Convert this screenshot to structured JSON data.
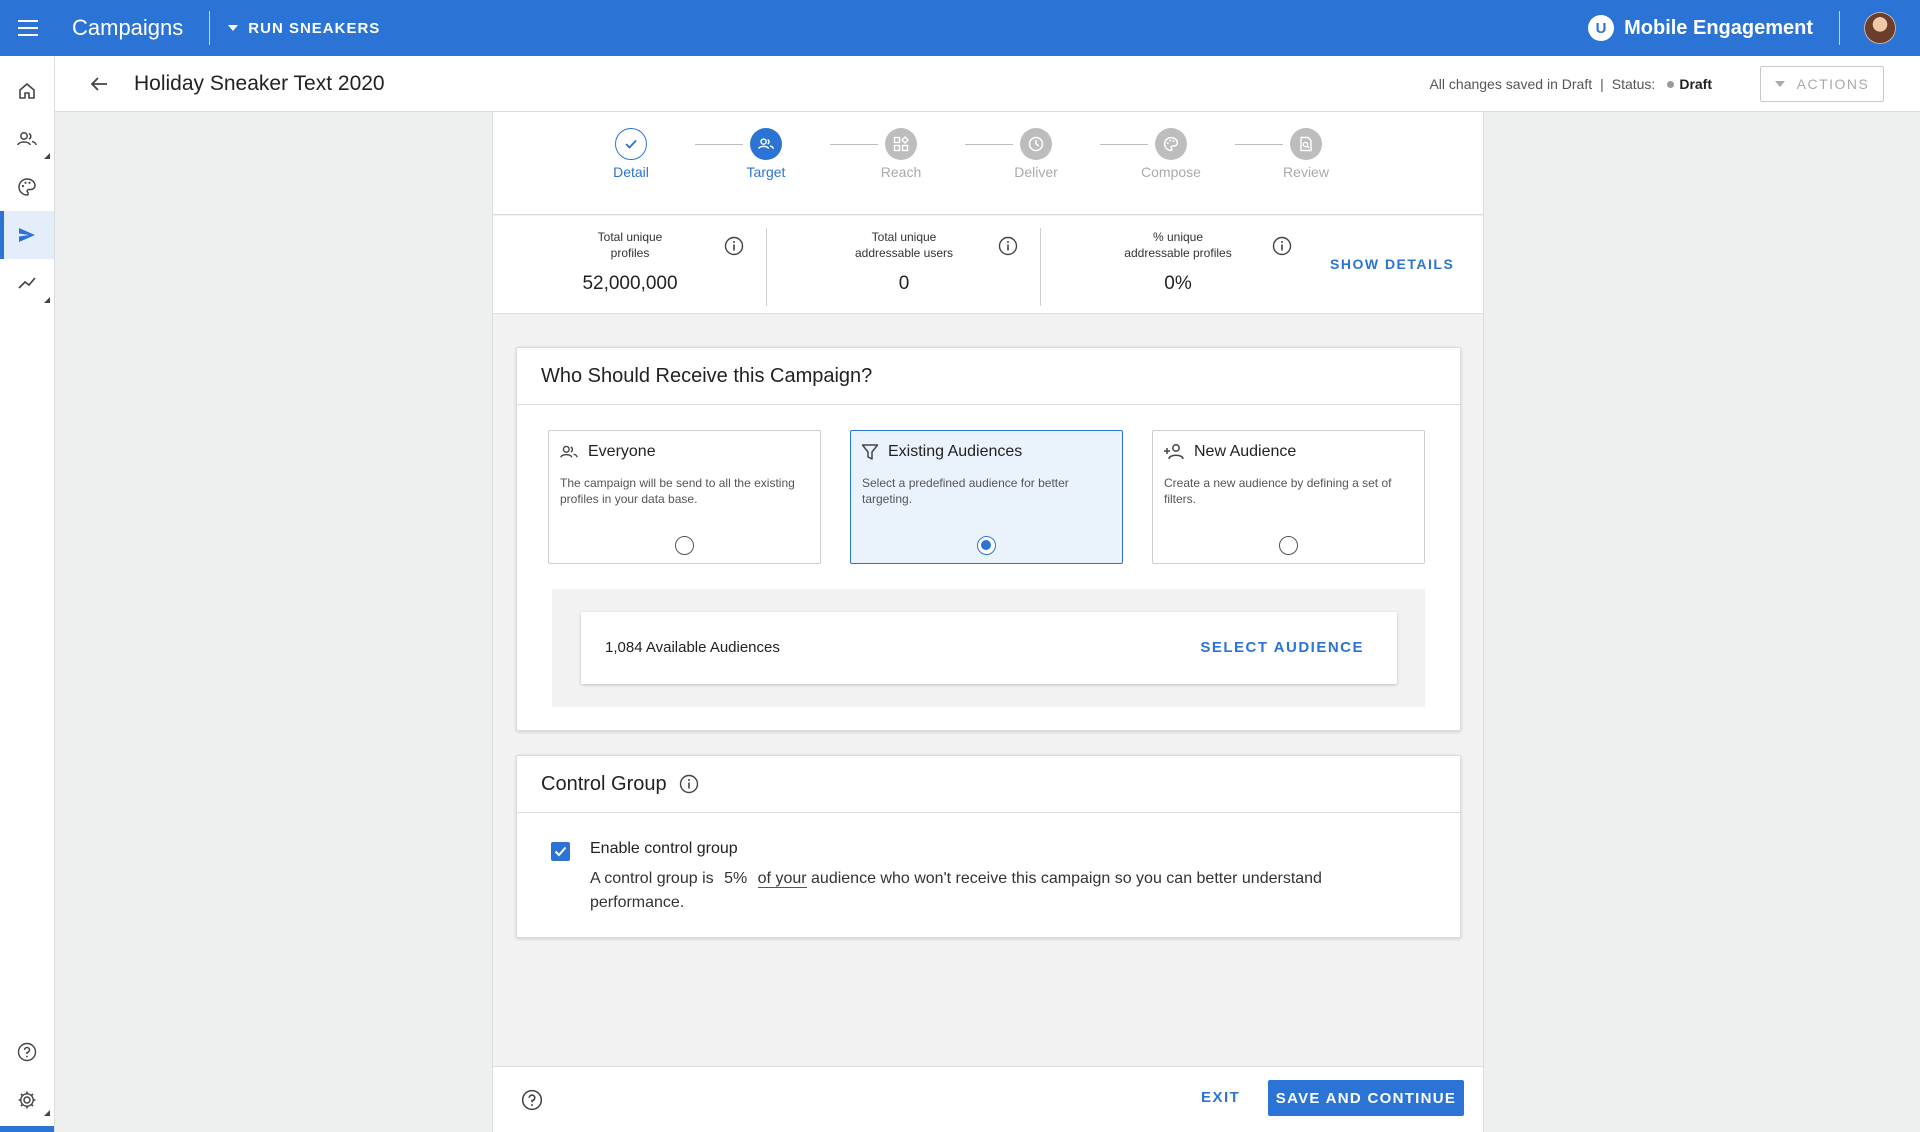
{
  "topbar": {
    "app_title": "Campaigns",
    "brand_selector": "RUN SNEAKERS",
    "logo_letter": "U",
    "product_name": "Mobile Engagement",
    "accent_color": "#2b74d6"
  },
  "leftnav": {
    "items": [
      {
        "icon": "home-icon"
      },
      {
        "icon": "people-icon"
      },
      {
        "icon": "palette-icon"
      },
      {
        "icon": "send-icon",
        "active": true
      },
      {
        "icon": "trend-icon"
      }
    ],
    "bottom": [
      {
        "icon": "help-icon"
      },
      {
        "icon": "gear-icon"
      }
    ]
  },
  "header": {
    "title": "Holiday Sneaker Text 2020",
    "save_state": "All changes saved in Draft",
    "divider": "|",
    "status_label": "Status:",
    "status_value": "Draft",
    "actions_label": "ACTIONS"
  },
  "stepper": {
    "steps": [
      {
        "label": "Detail",
        "state": "done"
      },
      {
        "label": "Target",
        "state": "current"
      },
      {
        "label": "Reach",
        "state": "pending"
      },
      {
        "label": "Deliver",
        "state": "pending"
      },
      {
        "label": "Compose",
        "state": "pending"
      },
      {
        "label": "Review",
        "state": "pending"
      }
    ]
  },
  "stats": {
    "items": [
      {
        "label_line1": "Total unique",
        "label_line2": "profiles",
        "value": "52,000,000"
      },
      {
        "label_line1": "Total unique",
        "label_line2": "addressable users",
        "value": "0"
      },
      {
        "label_line1": "% unique",
        "label_line2": "addressable profiles",
        "value": "0%"
      }
    ],
    "show_details": "SHOW DETAILS"
  },
  "audience_card": {
    "title": "Who Should Receive this Campaign?",
    "options": [
      {
        "title": "Everyone",
        "desc": "The campaign will be send to all the existing profiles in your data base.",
        "icon": "people-icon",
        "selected": false
      },
      {
        "title": "Existing Audiences",
        "desc": "Select a predefined audience for better targeting.",
        "icon": "filter-icon",
        "selected": true
      },
      {
        "title": "New Audience",
        "desc": "Create a new audience by defining a set of filters.",
        "icon": "person-add-icon",
        "selected": false
      }
    ],
    "available_count": "1,084 Available Audiences",
    "select_label": "SELECT AUDIENCE"
  },
  "control_group": {
    "title": "Control Group",
    "checkbox_label": "Enable control group",
    "checked": true,
    "desc_prefix": "A control group is",
    "percent": "5%",
    "desc_link": "of your",
    "desc_suffix": "audience who won't receive this campaign so you can better understand performance."
  },
  "footer": {
    "exit_label": "EXIT",
    "save_label": "SAVE AND CONTINUE"
  }
}
